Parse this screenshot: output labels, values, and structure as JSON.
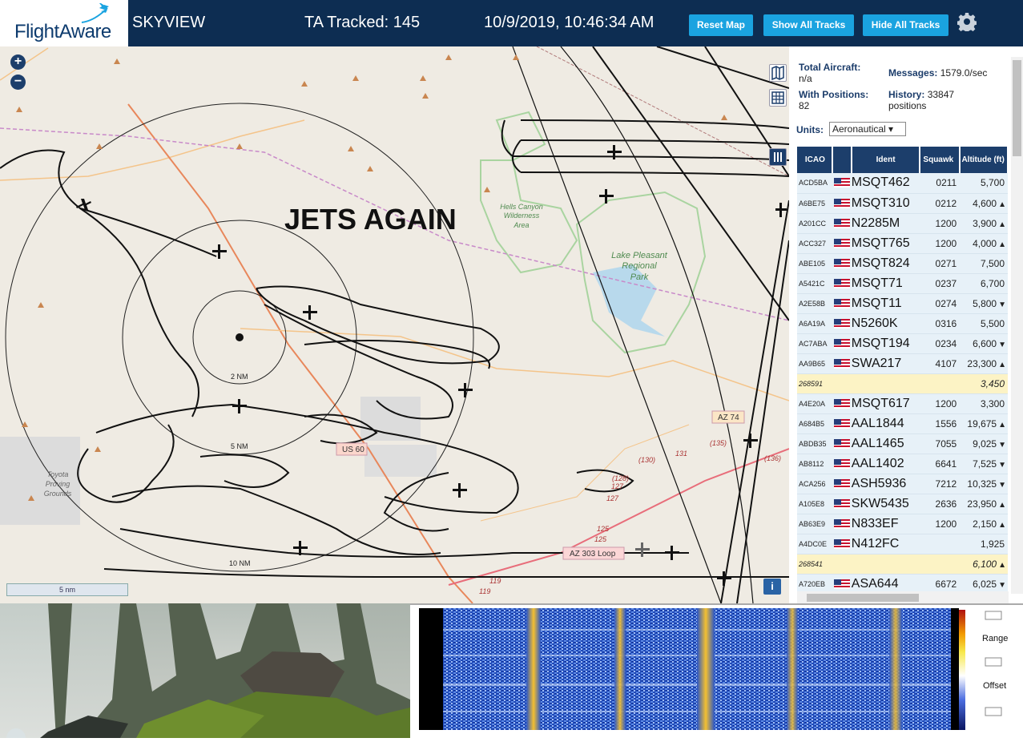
{
  "header": {
    "logo_text": "FlightAware",
    "title": "SKYVIEW",
    "tracked": "TA Tracked: 145",
    "datetime": "10/9/2019, 10:46:34 AM",
    "buttons": {
      "reset_map": "Reset Map",
      "show_all": "Show All Tracks",
      "hide_all": "Hide All Tracks"
    },
    "brand_color": "#0d2d52",
    "button_color": "#1aa3e0"
  },
  "map": {
    "zoom_in": "+",
    "zoom_out": "−",
    "overlay_text": "JETS AGAIN",
    "range_labels": [
      "2 NM",
      "5 NM",
      "10 NM"
    ],
    "place_labels": {
      "wilderness": [
        "Hells Canyon",
        "Wilderness",
        "Area"
      ],
      "park": [
        "Lake Pleasant",
        "Regional",
        "Park"
      ],
      "proving": [
        "Toyota",
        "Proving",
        "Grounds"
      ]
    },
    "road_labels": [
      "AZ 74",
      "US 60",
      "AZ 303 Loop"
    ],
    "route_numbers": [
      "(135)",
      "(136)",
      "(130)",
      "131",
      "(128)",
      "127",
      "127",
      "125",
      "125",
      "119",
      "119"
    ],
    "scale": "5 nm",
    "info": "i"
  },
  "stats": {
    "total_label": "Total Aircraft:",
    "total_value": "n/a",
    "positions_label": "With Positions:",
    "positions_value": "82",
    "messages_label": "Messages:",
    "messages_value": "1579.0/sec",
    "history_label": "History:",
    "history_value": "33847",
    "history_unit": "positions",
    "units_label": "Units:",
    "units_value": "Aeronautical ▾"
  },
  "table": {
    "headers": [
      "ICAO",
      "",
      "Ident",
      "Squawk",
      "Altitude (ft)"
    ],
    "rows": [
      {
        "icao": "ACD5BA",
        "flag": true,
        "ident": "MSQT462",
        "squawk": "0211",
        "alt": "5,700",
        "trend": "",
        "hl": false
      },
      {
        "icao": "A6BE75",
        "flag": true,
        "ident": "MSQT310",
        "squawk": "0212",
        "alt": "4,600",
        "trend": "▲",
        "hl": false
      },
      {
        "icao": "A201CC",
        "flag": true,
        "ident": "N2285M",
        "squawk": "1200",
        "alt": "3,900",
        "trend": "▲",
        "hl": false
      },
      {
        "icao": "ACC327",
        "flag": true,
        "ident": "MSQT765",
        "squawk": "1200",
        "alt": "4,000",
        "trend": "▲",
        "hl": false
      },
      {
        "icao": "ABE105",
        "flag": true,
        "ident": "MSQT824",
        "squawk": "0271",
        "alt": "7,500",
        "trend": "",
        "hl": false
      },
      {
        "icao": "A5421C",
        "flag": true,
        "ident": "MSQT71",
        "squawk": "0237",
        "alt": "6,700",
        "trend": "",
        "hl": false
      },
      {
        "icao": "A2E58B",
        "flag": true,
        "ident": "MSQT11",
        "squawk": "0274",
        "alt": "5,800",
        "trend": "▼",
        "hl": false
      },
      {
        "icao": "A6A19A",
        "flag": true,
        "ident": "N5260K",
        "squawk": "0316",
        "alt": "5,500",
        "trend": "",
        "hl": false
      },
      {
        "icao": "AC7ABA",
        "flag": true,
        "ident": "MSQT194",
        "squawk": "0234",
        "alt": "6,600",
        "trend": "▼",
        "hl": false
      },
      {
        "icao": "AA9B65",
        "flag": true,
        "ident": "SWA217",
        "squawk": "4107",
        "alt": "23,300",
        "trend": "▲",
        "hl": false
      },
      {
        "icao": "268591",
        "flag": false,
        "ident": "",
        "squawk": "",
        "alt": "3,450",
        "trend": "",
        "hl": true
      },
      {
        "icao": "A4E20A",
        "flag": true,
        "ident": "MSQT617",
        "squawk": "1200",
        "alt": "3,300",
        "trend": "",
        "hl": false
      },
      {
        "icao": "A684B5",
        "flag": true,
        "ident": "AAL1844",
        "squawk": "1556",
        "alt": "19,675",
        "trend": "▲",
        "hl": false
      },
      {
        "icao": "ABDB35",
        "flag": true,
        "ident": "AAL1465",
        "squawk": "7055",
        "alt": "9,025",
        "trend": "▼",
        "hl": false
      },
      {
        "icao": "AB8112",
        "flag": true,
        "ident": "AAL1402",
        "squawk": "6641",
        "alt": "7,525",
        "trend": "▼",
        "hl": false
      },
      {
        "icao": "ACA256",
        "flag": true,
        "ident": "ASH5936",
        "squawk": "7212",
        "alt": "10,325",
        "trend": "▼",
        "hl": false
      },
      {
        "icao": "A105E8",
        "flag": true,
        "ident": "SKW5435",
        "squawk": "2636",
        "alt": "23,950",
        "trend": "▲",
        "hl": false
      },
      {
        "icao": "AB63E9",
        "flag": true,
        "ident": "N833EF",
        "squawk": "1200",
        "alt": "2,150",
        "trend": "▲",
        "hl": false
      },
      {
        "icao": "A4DC0E",
        "flag": true,
        "ident": "N412FC",
        "squawk": "",
        "alt": "1,925",
        "trend": "",
        "hl": false
      },
      {
        "icao": "268541",
        "flag": false,
        "ident": "",
        "squawk": "",
        "alt": "6,100",
        "trend": "▲",
        "hl": true
      },
      {
        "icao": "A720EB",
        "flag": true,
        "ident": "ASA644",
        "squawk": "6672",
        "alt": "6,025",
        "trend": "▼",
        "hl": false
      }
    ]
  },
  "spectrogram": {
    "range_label": "Range",
    "offset_label": "Offset"
  },
  "icons": {
    "zoom": "plus-minus",
    "map_layers": "map-icon",
    "grid": "grid-icon",
    "columns": "columns-icon",
    "settings": "gear-icon",
    "aircraft": "airplane-icon"
  }
}
